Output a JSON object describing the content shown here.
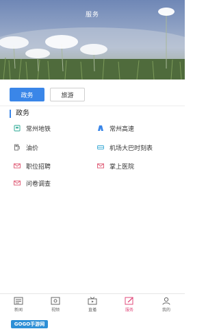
{
  "header": {
    "title": "服务"
  },
  "tabs": [
    {
      "label": "政务",
      "active": true
    },
    {
      "label": "旅游",
      "active": false
    }
  ],
  "section": {
    "title": "政务"
  },
  "services": [
    {
      "label": "常州地铁",
      "icon": "subway-icon",
      "color": "#4fb8a6"
    },
    {
      "label": "常州高速",
      "icon": "highway-icon",
      "color": "#3a86e8"
    },
    {
      "label": "油价",
      "icon": "oil-price-icon",
      "color": "#777777"
    },
    {
      "label": "机场大巴时刻表",
      "icon": "airport-bus-icon",
      "color": "#4ab0d8"
    },
    {
      "label": "职位招聘",
      "icon": "mail-icon",
      "color": "#e0607a"
    },
    {
      "label": "掌上医院",
      "icon": "mail-icon",
      "color": "#e0607a"
    },
    {
      "label": "问卷调查",
      "icon": "mail-icon",
      "color": "#e0607a"
    }
  ],
  "bottom_nav": [
    {
      "label": "新闻",
      "icon": "news-icon",
      "active": false
    },
    {
      "label": "视频",
      "icon": "video-icon",
      "active": false
    },
    {
      "label": "直播",
      "icon": "live-tv-icon",
      "active": false
    },
    {
      "label": "服务",
      "icon": "service-edit-icon",
      "active": true
    },
    {
      "label": "我的",
      "icon": "profile-icon",
      "active": false
    }
  ],
  "watermark": {
    "text": "GOGO手游网"
  },
  "colors": {
    "accent": "#3a86e8",
    "active_nav": "#e0487a"
  }
}
